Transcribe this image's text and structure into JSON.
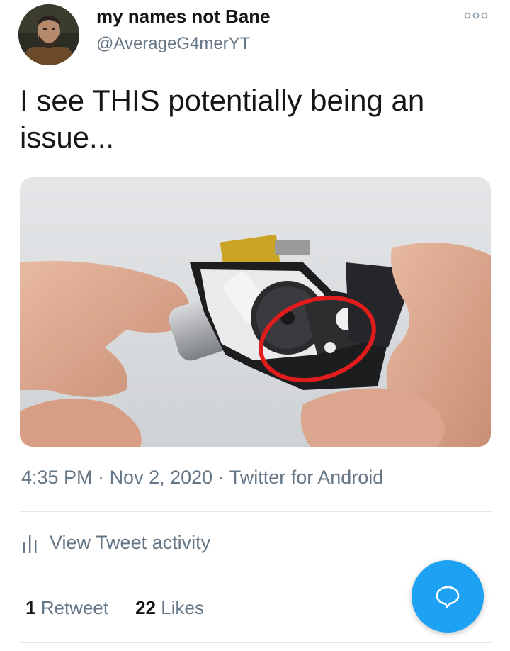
{
  "author": {
    "display_name": "my names not Bane",
    "handle": "@AverageG4merYT",
    "avatar_icon": "user-avatar-photo"
  },
  "menu": {
    "icon": "more-icon"
  },
  "tweet": {
    "text": "I see THIS potentially being an issue...",
    "media_description_icon": "attached-photo"
  },
  "meta": {
    "time": "4:35 PM",
    "date": "Nov 2, 2020",
    "client": "Twitter for Android",
    "separator": " · "
  },
  "activity": {
    "label": "View Tweet activity",
    "icon": "bar-chart-icon"
  },
  "stats": {
    "retweets_count": "1",
    "retweets_label": "Retweet",
    "likes_count": "22",
    "likes_label": "Likes"
  },
  "compose": {
    "icon": "speech-bubble-icon"
  },
  "colors": {
    "accent": "#1da1f2",
    "secondary_text": "#657786",
    "primary_text": "#14171a",
    "divider": "#e1e8ed"
  }
}
